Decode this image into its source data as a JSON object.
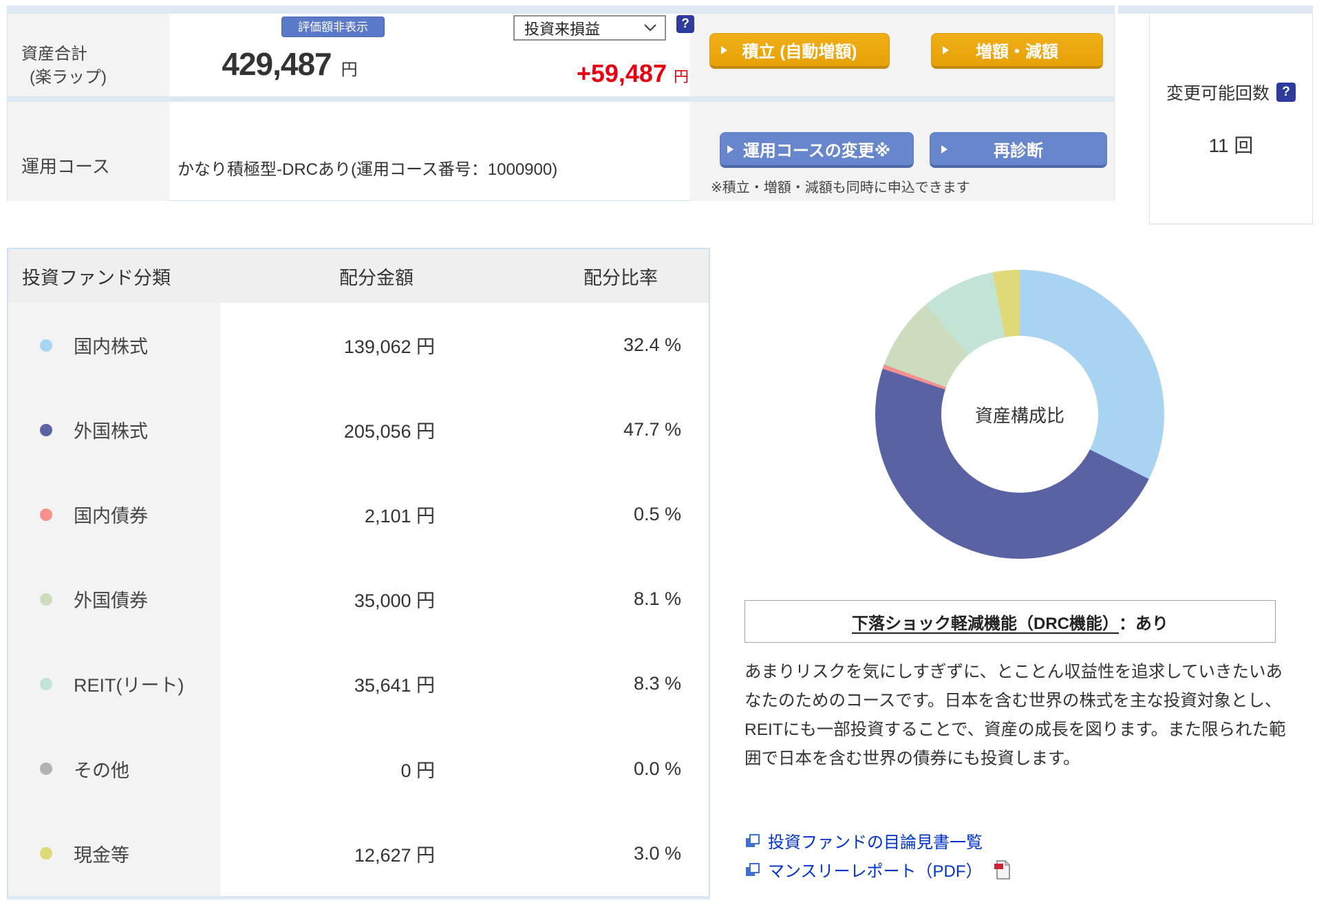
{
  "header": {
    "asset_label_line1": "資産合計",
    "asset_label_line2": "(楽ラップ)",
    "hide_badge": "評価額非表示",
    "total_amount": "429,487",
    "total_unit": "円",
    "pl_select_value": "投資来損益",
    "pl_amount": "+59,487",
    "pl_unit": "円",
    "btn_tsumitate": "積立 (自動増額)",
    "btn_zogaku": "増額・減額",
    "course_label": "運用コース",
    "course_value": "かなり積極型-DRCあり(運用コース番号：1000900)",
    "btn_course_change": "運用コースの変更※",
    "btn_rediagnosis": "再診断",
    "note": "※積立・増額・減額も同時に申込できます",
    "change_count_label": "変更可能回数",
    "change_count_value": "11 回"
  },
  "allocation_table": {
    "headers": [
      "投資ファンド分類",
      "配分金額",
      "配分比率"
    ],
    "rows": [
      {
        "label": "国内株式",
        "color": "#a8d4f2",
        "amount": "139,062 円",
        "ratio": "32.4 %"
      },
      {
        "label": "外国株式",
        "color": "#5a62a4",
        "amount": "205,056 円",
        "ratio": "47.7 %"
      },
      {
        "label": "国内債券",
        "color": "#f5908f",
        "amount": "2,101 円",
        "ratio": "0.5 %"
      },
      {
        "label": "外国債券",
        "color": "#cbddbc",
        "amount": "35,000 円",
        "ratio": "8.1 %"
      },
      {
        "label": "REIT(リート)",
        "color": "#c3e4d5",
        "amount": "35,641 円",
        "ratio": "8.3 %"
      },
      {
        "label": "その他",
        "color": "#b3b3b3",
        "amount": "0 円",
        "ratio": "0.0 %"
      },
      {
        "label": "現金等",
        "color": "#dfd978",
        "amount": "12,627 円",
        "ratio": "3.0 %"
      }
    ]
  },
  "chart_data": {
    "type": "pie",
    "donut": true,
    "center_label": "資産構成比",
    "categories": [
      "国内株式",
      "外国株式",
      "国内債券",
      "外国債券",
      "REIT(リート)",
      "現金等"
    ],
    "values": [
      32.4,
      47.7,
      0.5,
      8.1,
      8.3,
      3.0
    ],
    "colors": [
      "#a8d4f2",
      "#5a62a4",
      "#f5908f",
      "#cbddbc",
      "#c3e4d5",
      "#dfd978"
    ],
    "start_angle_deg": 0,
    "direction": "clockwise",
    "legend_position": "none"
  },
  "drc": {
    "title_underlined": "下落ショック軽減機能（DRC機能）",
    "title_suffix": "：あり",
    "description": "あまりリスクを気にしすぎずに、とことん収益性を追求していきたいあなたのためのコースです。日本を含む世界の株式を主な投資対象とし、REITにも一部投資することで、資産の成長を図ります。また限られた範囲で日本を含む世界の債券にも投資します。"
  },
  "links": {
    "prospectus": "投資ファンドの目論見書一覧",
    "monthly_report": "マンスリーレポート（PDF）"
  }
}
